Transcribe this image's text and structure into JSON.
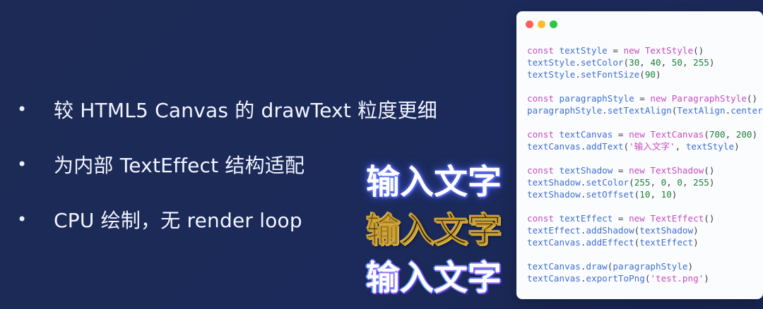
{
  "bullets": [
    {
      "dot": "•",
      "text": "较 HTML5 Canvas 的 drawText 粒度更细"
    },
    {
      "dot": "•",
      "text": "为内部 TextEffect 结构适配"
    },
    {
      "dot": "•",
      "text": "CPU 绘制，无 render loop"
    }
  ],
  "samples": [
    "输入文字",
    "输入文字",
    "输入文字"
  ],
  "code_window": {
    "lines": [
      {
        "tokens": [
          [
            "kw",
            "const "
          ],
          [
            "var",
            "textStyle"
          ],
          [
            "punc",
            " = "
          ],
          [
            "kw",
            "new "
          ],
          [
            "cls",
            "TextStyle"
          ],
          [
            "punc",
            "()"
          ]
        ]
      },
      {
        "tokens": [
          [
            "var",
            "textStyle"
          ],
          [
            "punc",
            "."
          ],
          [
            "fn",
            "setColor"
          ],
          [
            "punc",
            "("
          ],
          [
            "num",
            "30"
          ],
          [
            "punc",
            ", "
          ],
          [
            "num",
            "40"
          ],
          [
            "punc",
            ", "
          ],
          [
            "num",
            "50"
          ],
          [
            "punc",
            ", "
          ],
          [
            "num",
            "255"
          ],
          [
            "punc",
            ")"
          ]
        ]
      },
      {
        "tokens": [
          [
            "var",
            "textStyle"
          ],
          [
            "punc",
            "."
          ],
          [
            "fn",
            "setFontSize"
          ],
          [
            "punc",
            "("
          ],
          [
            "num",
            "90"
          ],
          [
            "punc",
            ")"
          ]
        ]
      },
      {
        "blank": true
      },
      {
        "tokens": [
          [
            "kw",
            "const "
          ],
          [
            "var",
            "paragraphStyle"
          ],
          [
            "punc",
            " = "
          ],
          [
            "kw",
            "new "
          ],
          [
            "cls",
            "ParagraphStyle"
          ],
          [
            "punc",
            "()"
          ]
        ]
      },
      {
        "tokens": [
          [
            "var",
            "paragraphStyle"
          ],
          [
            "punc",
            "."
          ],
          [
            "fn",
            "setTextAlign"
          ],
          [
            "punc",
            "("
          ],
          [
            "var",
            "TextAlign"
          ],
          [
            "punc",
            "."
          ],
          [
            "var",
            "center"
          ],
          [
            "punc",
            ")"
          ]
        ]
      },
      {
        "blank": true
      },
      {
        "tokens": [
          [
            "kw",
            "const "
          ],
          [
            "var",
            "textCanvas"
          ],
          [
            "punc",
            " = "
          ],
          [
            "kw",
            "new "
          ],
          [
            "cls",
            "TextCanvas"
          ],
          [
            "punc",
            "("
          ],
          [
            "num",
            "700"
          ],
          [
            "punc",
            ", "
          ],
          [
            "num",
            "200"
          ],
          [
            "punc",
            ")"
          ]
        ]
      },
      {
        "tokens": [
          [
            "var",
            "textCanvas"
          ],
          [
            "punc",
            "."
          ],
          [
            "fn",
            "addText"
          ],
          [
            "punc",
            "("
          ],
          [
            "str",
            "'输入文字'"
          ],
          [
            "punc",
            ", "
          ],
          [
            "var",
            "textStyle"
          ],
          [
            "punc",
            ")"
          ]
        ]
      },
      {
        "blank": true
      },
      {
        "tokens": [
          [
            "kw",
            "const "
          ],
          [
            "var",
            "textShadow"
          ],
          [
            "punc",
            " = "
          ],
          [
            "kw",
            "new "
          ],
          [
            "cls",
            "TextShadow"
          ],
          [
            "punc",
            "()"
          ]
        ]
      },
      {
        "tokens": [
          [
            "var",
            "textShadow"
          ],
          [
            "punc",
            "."
          ],
          [
            "fn",
            "setColor"
          ],
          [
            "punc",
            "("
          ],
          [
            "num",
            "255"
          ],
          [
            "punc",
            ", "
          ],
          [
            "num",
            "0"
          ],
          [
            "punc",
            ", "
          ],
          [
            "num",
            "0"
          ],
          [
            "punc",
            ", "
          ],
          [
            "num",
            "255"
          ],
          [
            "punc",
            ")"
          ]
        ]
      },
      {
        "tokens": [
          [
            "var",
            "textShadow"
          ],
          [
            "punc",
            "."
          ],
          [
            "fn",
            "setOffset"
          ],
          [
            "punc",
            "("
          ],
          [
            "num",
            "10"
          ],
          [
            "punc",
            ", "
          ],
          [
            "num",
            "10"
          ],
          [
            "punc",
            ")"
          ]
        ]
      },
      {
        "blank": true
      },
      {
        "tokens": [
          [
            "kw",
            "const "
          ],
          [
            "var",
            "textEffect"
          ],
          [
            "punc",
            " = "
          ],
          [
            "kw",
            "new "
          ],
          [
            "cls",
            "TextEffect"
          ],
          [
            "punc",
            "()"
          ]
        ]
      },
      {
        "tokens": [
          [
            "var",
            "textEffect"
          ],
          [
            "punc",
            "."
          ],
          [
            "fn",
            "addShadow"
          ],
          [
            "punc",
            "("
          ],
          [
            "var",
            "textShadow"
          ],
          [
            "punc",
            ")"
          ]
        ]
      },
      {
        "tokens": [
          [
            "var",
            "textCanvas"
          ],
          [
            "punc",
            "."
          ],
          [
            "fn",
            "addEffect"
          ],
          [
            "punc",
            "("
          ],
          [
            "var",
            "textEffect"
          ],
          [
            "punc",
            ")"
          ]
        ]
      },
      {
        "blank": true
      },
      {
        "tokens": [
          [
            "var",
            "textCanvas"
          ],
          [
            "punc",
            "."
          ],
          [
            "fn",
            "draw"
          ],
          [
            "punc",
            "("
          ],
          [
            "var",
            "paragraphStyle"
          ],
          [
            "punc",
            ")"
          ]
        ]
      },
      {
        "tokens": [
          [
            "var",
            "textCanvas"
          ],
          [
            "punc",
            "."
          ],
          [
            "fn",
            "exportToPng"
          ],
          [
            "punc",
            "("
          ],
          [
            "str",
            "'test.png'"
          ],
          [
            "punc",
            ")"
          ]
        ]
      }
    ]
  }
}
